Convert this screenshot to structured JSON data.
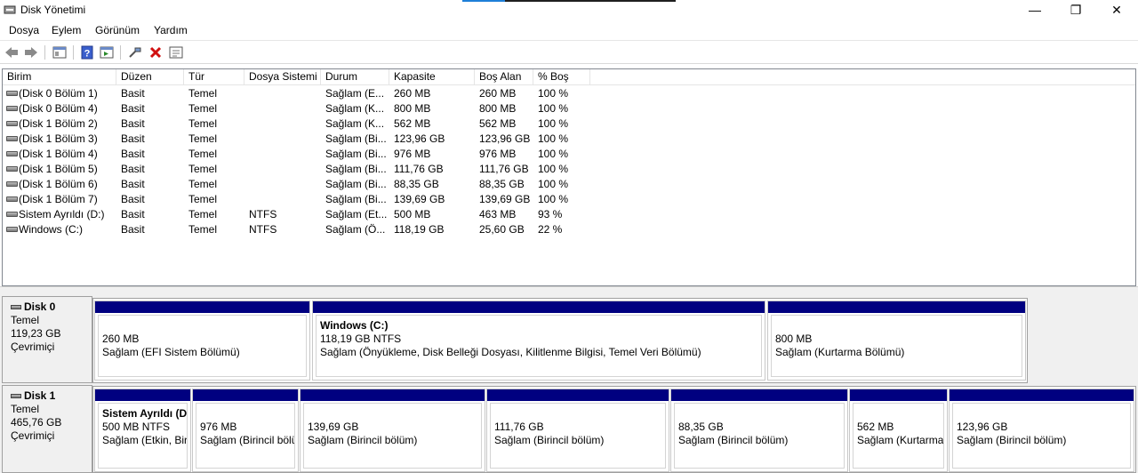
{
  "window": {
    "title": "Disk Yönetimi",
    "min_glyph": "—",
    "max_glyph": "❐",
    "close_glyph": "✕"
  },
  "menu": [
    "Dosya",
    "Eylem",
    "Görünüm",
    "Yardım"
  ],
  "toolbar": [
    "back-arrow-icon",
    "forward-arrow-icon",
    "console-tree-icon",
    "help-icon",
    "action-pane-icon",
    "connect-icon",
    "delete-icon",
    "properties-icon"
  ],
  "columns": [
    "Birim",
    "Düzen",
    "Tür",
    "Dosya Sistemi",
    "Durum",
    "Kapasite",
    "Boş Alan",
    "% Boş"
  ],
  "volumes": [
    [
      "(Disk 0 Bölüm 1)",
      "Basit",
      "Temel",
      "",
      "Sağlam (E...",
      "260 MB",
      "260 MB",
      "100 %"
    ],
    [
      "(Disk 0 Bölüm 4)",
      "Basit",
      "Temel",
      "",
      "Sağlam (K...",
      "800 MB",
      "800 MB",
      "100 %"
    ],
    [
      "(Disk 1 Bölüm 2)",
      "Basit",
      "Temel",
      "",
      "Sağlam (K...",
      "562 MB",
      "562 MB",
      "100 %"
    ],
    [
      "(Disk 1 Bölüm 3)",
      "Basit",
      "Temel",
      "",
      "Sağlam (Bi...",
      "123,96 GB",
      "123,96 GB",
      "100 %"
    ],
    [
      "(Disk 1 Bölüm 4)",
      "Basit",
      "Temel",
      "",
      "Sağlam (Bi...",
      "976 MB",
      "976 MB",
      "100 %"
    ],
    [
      "(Disk 1 Bölüm 5)",
      "Basit",
      "Temel",
      "",
      "Sağlam (Bi...",
      "111,76 GB",
      "111,76 GB",
      "100 %"
    ],
    [
      "(Disk 1 Bölüm 6)",
      "Basit",
      "Temel",
      "",
      "Sağlam (Bi...",
      "88,35 GB",
      "88,35 GB",
      "100 %"
    ],
    [
      "(Disk 1 Bölüm 7)",
      "Basit",
      "Temel",
      "",
      "Sağlam (Bi...",
      "139,69 GB",
      "139,69 GB",
      "100 %"
    ],
    [
      "Sistem Ayrıldı (D:)",
      "Basit",
      "Temel",
      "NTFS",
      "Sağlam (Et...",
      "500 MB",
      "463 MB",
      "93 %"
    ],
    [
      "Windows (C:)",
      "Basit",
      "Temel",
      "NTFS",
      "Sağlam (Ö...",
      "118,19 GB",
      "25,60 GB",
      "22 %"
    ]
  ],
  "disks": [
    {
      "name": "Disk 0",
      "type": "Temel",
      "size": "119,23 GB",
      "status": "Çevrimiçi",
      "partitions": [
        {
          "name": "",
          "size": "260 MB",
          "status": "Sağlam (EFI Sistem Bölümü)"
        },
        {
          "name": "Windows  (C:)",
          "size": "118,19 GB NTFS",
          "status": "Sağlam (Önyükleme, Disk Belleği Dosyası, Kilitlenme Bilgisi, Temel Veri Bölümü)"
        },
        {
          "name": "",
          "size": "800 MB",
          "status": "Sağlam (Kurtarma Bölümü)"
        }
      ]
    },
    {
      "name": "Disk 1",
      "type": "Temel",
      "size": "465,76 GB",
      "status": "Çevrimiçi",
      "partitions": [
        {
          "name": "Sistem Ayrıldı  (D",
          "size": "500 MB NTFS",
          "status": "Sağlam (Etkin, Biri"
        },
        {
          "name": "",
          "size": "976 MB",
          "status": "Sağlam (Birincil bölü"
        },
        {
          "name": "",
          "size": "139,69 GB",
          "status": "Sağlam (Birincil bölüm)"
        },
        {
          "name": "",
          "size": "111,76 GB",
          "status": "Sağlam (Birincil bölüm)"
        },
        {
          "name": "",
          "size": "88,35 GB",
          "status": "Sağlam (Birincil bölüm)"
        },
        {
          "name": "",
          "size": "562 MB",
          "status": "Sağlam (Kurtarma"
        },
        {
          "name": "",
          "size": "123,96 GB",
          "status": "Sağlam (Birincil bölüm)"
        }
      ]
    }
  ],
  "colors": {
    "partition_header": "#000080",
    "pane_background": "#f0f0f0",
    "delete_icon": "#d01010",
    "help_icon": "#3a5fcd"
  }
}
